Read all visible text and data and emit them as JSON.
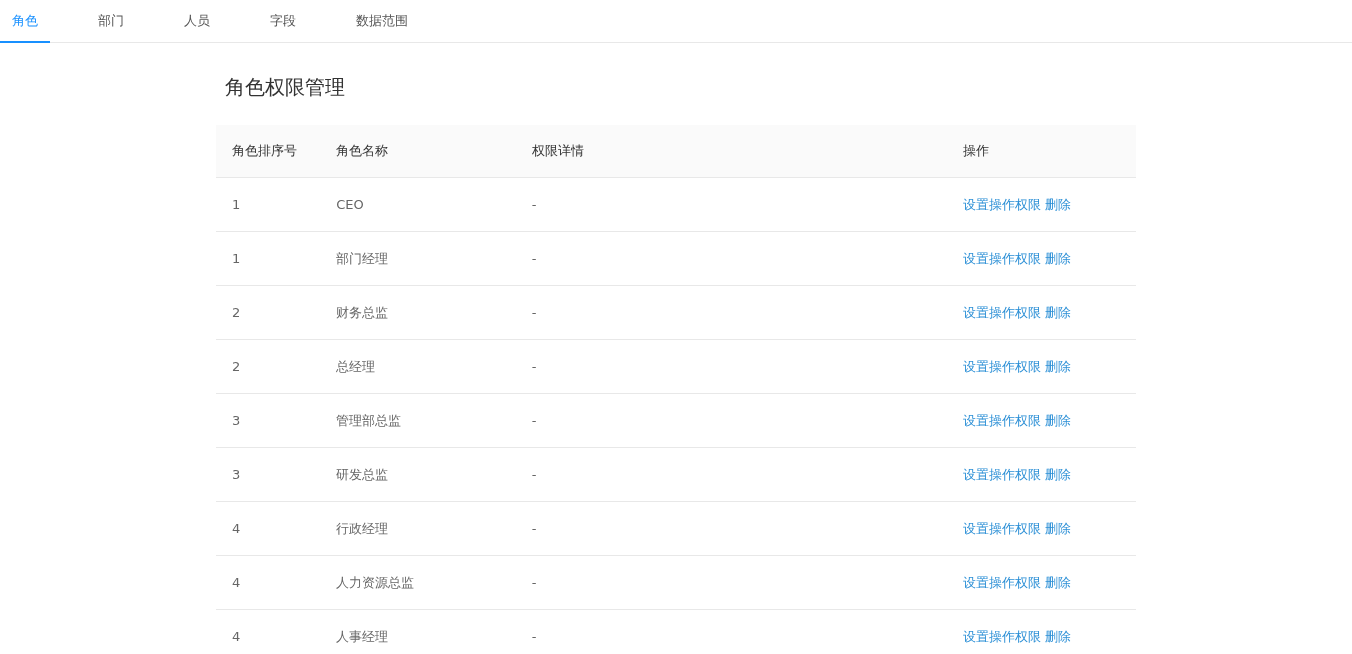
{
  "tabs": [
    {
      "label": "角色",
      "selected": true
    },
    {
      "label": "部门",
      "selected": false
    },
    {
      "label": "人员",
      "selected": false
    },
    {
      "label": "字段",
      "selected": false
    },
    {
      "label": "数据范围",
      "selected": false
    }
  ],
  "title": "角色权限管理",
  "table": {
    "columns": [
      "角色排序号",
      "角色名称",
      "权限详情",
      "操作"
    ],
    "rows": [
      {
        "order": "1",
        "name": "CEO",
        "details": "-",
        "actions": [
          "设置操作权限",
          "删除"
        ]
      },
      {
        "order": "1",
        "name": "部门经理",
        "details": "-",
        "actions": [
          "设置操作权限",
          "删除"
        ]
      },
      {
        "order": "2",
        "name": "财务总监",
        "details": "-",
        "actions": [
          "设置操作权限",
          "删除"
        ]
      },
      {
        "order": "2",
        "name": "总经理",
        "details": "-",
        "actions": [
          "设置操作权限",
          "删除"
        ]
      },
      {
        "order": "3",
        "name": "管理部总监",
        "details": "-",
        "actions": [
          "设置操作权限",
          "删除"
        ]
      },
      {
        "order": "3",
        "name": "研发总监",
        "details": "-",
        "actions": [
          "设置操作权限",
          "删除"
        ]
      },
      {
        "order": "4",
        "name": "行政经理",
        "details": "-",
        "actions": [
          "设置操作权限",
          "删除"
        ]
      },
      {
        "order": "4",
        "name": "人力资源总监",
        "details": "-",
        "actions": [
          "设置操作权限",
          "删除"
        ]
      },
      {
        "order": "4",
        "name": "人事经理",
        "details": "-",
        "actions": [
          "设置操作权限",
          "删除"
        ]
      }
    ]
  }
}
